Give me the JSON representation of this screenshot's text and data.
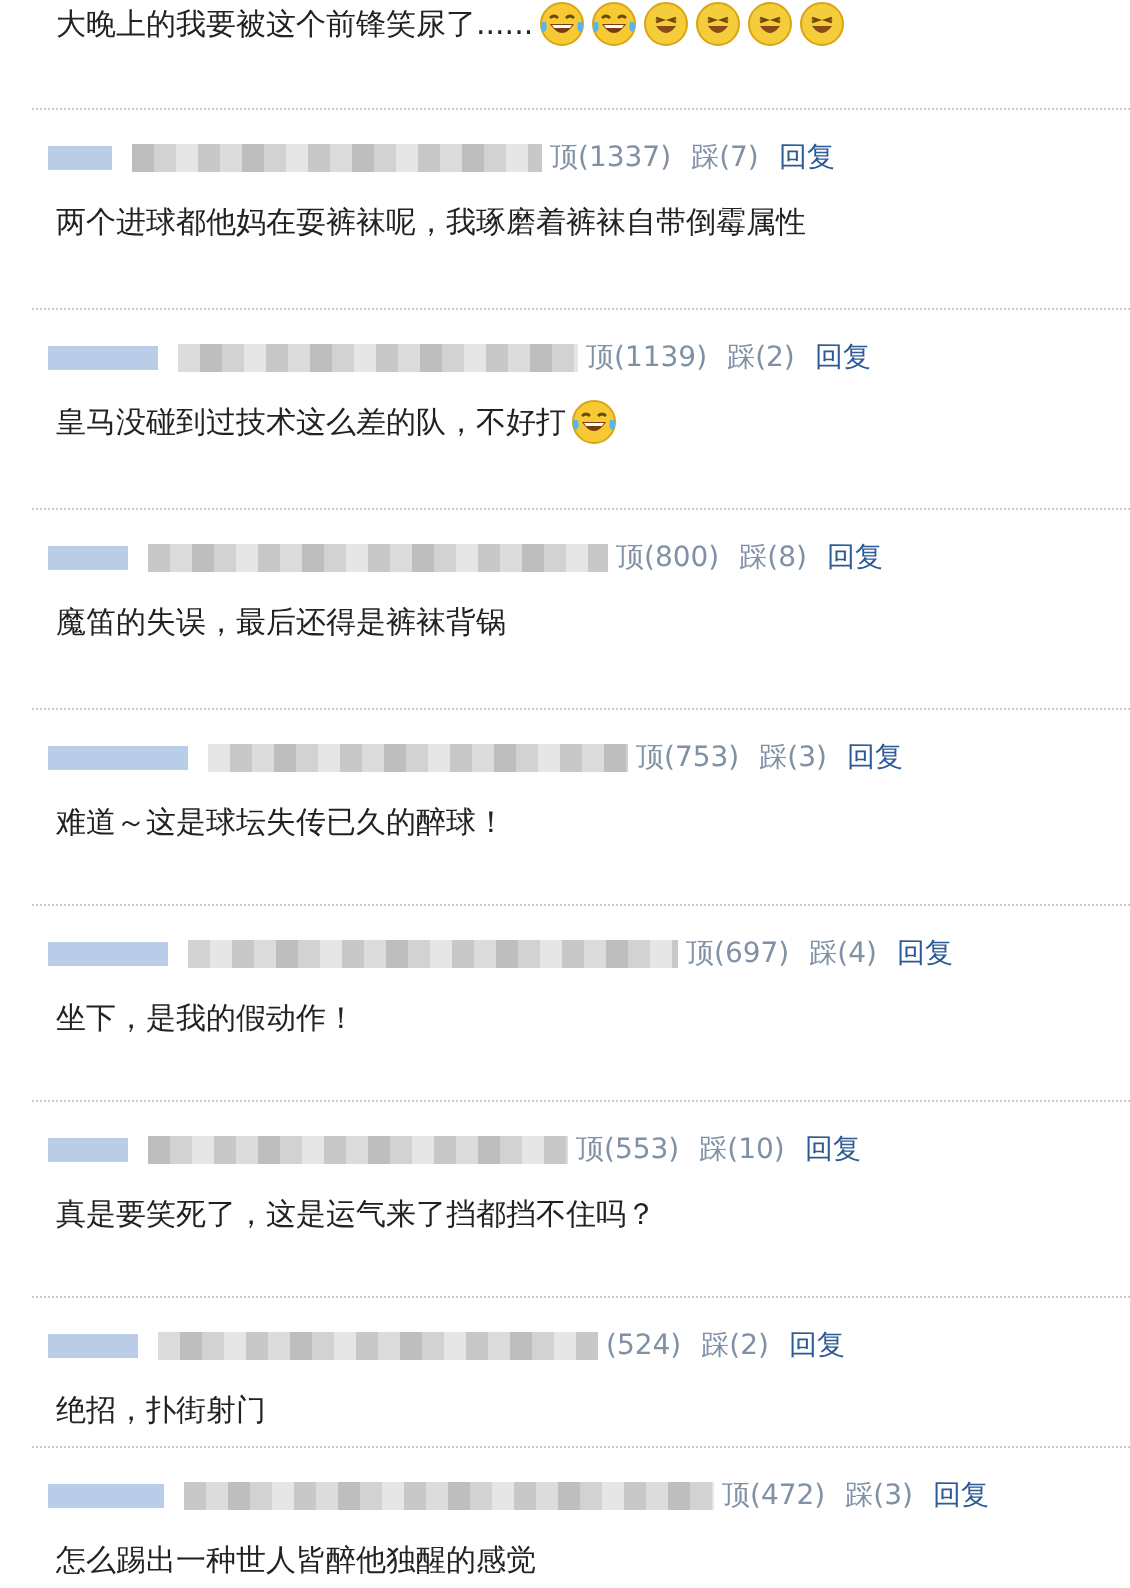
{
  "top_comment": {
    "text": "大晚上的我要被这个前锋笑尿了......",
    "emoji": [
      {
        "kind": "tears-of-joy"
      },
      {
        "kind": "tears-of-joy"
      },
      {
        "kind": "grin"
      },
      {
        "kind": "grin"
      },
      {
        "kind": "grin"
      },
      {
        "kind": "grin"
      }
    ]
  },
  "comments": [
    {
      "up": "顶(1337)",
      "down": "踩(7)",
      "reply": "回复",
      "text": "两个进球都他妈在耍裤袜呢，我琢磨着裤袜自带倒霉属性"
    },
    {
      "up": "顶(1139)",
      "down": "踩(2)",
      "reply": "回复",
      "text": "皇马没碰到过技术这么差的队，不好打",
      "emoji": [
        {
          "kind": "tears-of-joy"
        }
      ]
    },
    {
      "up": "顶(800)",
      "down": "踩(8)",
      "reply": "回复",
      "text": "魔笛的失误，最后还得是裤袜背锅"
    },
    {
      "up": "顶(753)",
      "down": "踩(3)",
      "reply": "回复",
      "text": "难道～这是球坛失传已久的醉球！"
    },
    {
      "up": "顶(697)",
      "down": "踩(4)",
      "reply": "回复",
      "text": "坐下，是我的假动作！"
    },
    {
      "up": "顶(553)",
      "down": "踩(10)",
      "reply": "回复",
      "text": "真是要笑死了，这是运气来了挡都挡不住吗？"
    },
    {
      "up": "(524)",
      "down": "踩(2)",
      "reply": "回复",
      "text": "绝招，扑街射门"
    },
    {
      "up": "顶(472)",
      "down": "踩(3)",
      "reply": "回复",
      "text": "怎么踢出一种世人皆醉他独醒的感觉"
    }
  ]
}
